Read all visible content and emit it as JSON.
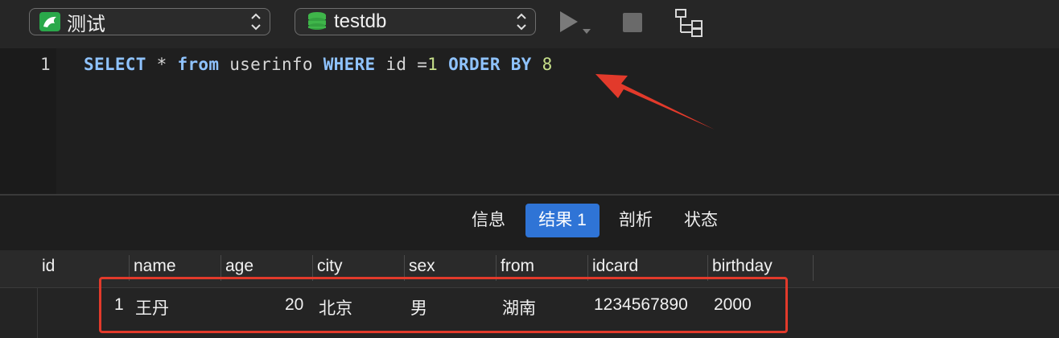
{
  "toolbar": {
    "connection": {
      "label": "测试",
      "icon": "dolphin-icon"
    },
    "database": {
      "label": "testdb",
      "icon": "database-icon"
    },
    "run_icon": "play-icon",
    "stop_icon": "stop-icon",
    "explain_icon": "tree-icon"
  },
  "editor": {
    "line_number": "1",
    "tokens": {
      "select": "SELECT",
      "star": " * ",
      "from": "from",
      "table": " userinfo ",
      "where": "WHERE",
      "cond": " id =",
      "one": "1",
      "space": " ",
      "orderby": "ORDER BY",
      "space2": " ",
      "eight": "8"
    }
  },
  "tabs": [
    {
      "label": "信息"
    },
    {
      "label": "结果 1"
    },
    {
      "label": "剖析"
    },
    {
      "label": "状态"
    }
  ],
  "grid": {
    "columns": [
      "id",
      "name",
      "age",
      "city",
      "sex",
      "from",
      "idcard",
      "birthday"
    ],
    "rows": [
      [
        "1",
        "王丹",
        "20",
        "北京",
        "男",
        "湖南",
        "1234567890",
        "2000"
      ]
    ]
  },
  "colors": {
    "accent": "#2f74d6",
    "annotation": "#e23a2b",
    "keyword": "#8fc3ff",
    "number": "#c7e08a"
  }
}
